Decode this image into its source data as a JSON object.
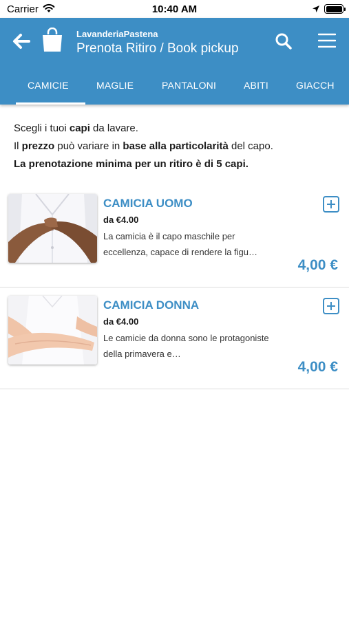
{
  "status_bar": {
    "carrier": "Carrier",
    "time": "10:40 AM",
    "icons": [
      "wifi-icon",
      "location-arrow-icon",
      "battery-icon"
    ]
  },
  "header": {
    "app_name": "LavanderiaPastena",
    "title": "Prenota Ritiro / Book pickup",
    "icons": [
      "back-arrow-icon",
      "shopping-bag-icon",
      "search-icon",
      "hamburger-menu-icon"
    ],
    "color": "#3d8ec5"
  },
  "tabs": [
    {
      "label": "CAMICIE",
      "active": true
    },
    {
      "label": "MAGLIE",
      "active": false
    },
    {
      "label": "PANTALONI",
      "active": false
    },
    {
      "label": "ABITI",
      "active": false
    },
    {
      "label": "GIACCH",
      "active": false
    }
  ],
  "intro": {
    "line1_a": "Scegli i tuoi ",
    "line1_b": "capi",
    "line1_c": " da lavare.",
    "line2_a": "Il ",
    "line2_b": "prezzo",
    "line2_c": " può variare in ",
    "line2_d": "base alla particolarità",
    "line2_e": " del capo.",
    "line3": "La prenotazione minima per un ritiro è di 5 capi."
  },
  "products": [
    {
      "name": "CAMICIA UOMO",
      "from_price": "da €4.00",
      "description": "La camicia è il capo maschile per eccellenza, capace di rendere la figu…",
      "price": "4,00 €"
    },
    {
      "name": "CAMICIA DONNA",
      "from_price": "da €4.00",
      "description": "Le camicie da donna sono le protagoniste della primavera e…",
      "price": "4,00 €"
    }
  ],
  "colors": {
    "accent": "#3d8ec5",
    "text": "#1a1a1a",
    "divider": "#dcdcdc"
  }
}
